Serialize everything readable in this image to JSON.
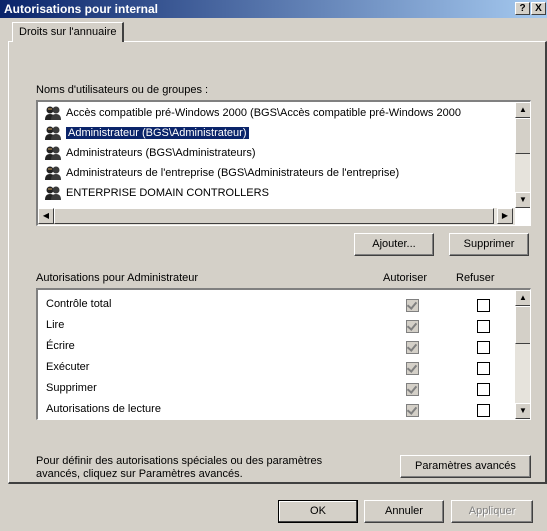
{
  "window": {
    "title": "Autorisations pour internal",
    "help_button": "?",
    "close_button": "X"
  },
  "tab": {
    "label": "Droits sur l'annuaire"
  },
  "users_section": {
    "label": "Noms d'utilisateurs ou de groupes :",
    "items": [
      {
        "label": "Accès compatible pré-Windows 2000 (BGS\\Accès compatible pré-Windows 2000"
      },
      {
        "label": "Administrateur (BGS\\Administrateur)",
        "selected": true
      },
      {
        "label": "Administrateurs (BGS\\Administrateurs)"
      },
      {
        "label": "Administrateurs de l'entreprise (BGS\\Administrateurs de l'entreprise)"
      },
      {
        "label": "ENTERPRISE DOMAIN CONTROLLERS"
      }
    ],
    "add_button": "Ajouter...",
    "remove_button": "Supprimer"
  },
  "permissions_section": {
    "label": "Autorisations pour Administrateur",
    "allow_header": "Autoriser",
    "deny_header": "Refuser",
    "rows": [
      {
        "label": "Contrôle total",
        "allow": true,
        "deny": false
      },
      {
        "label": "Lire",
        "allow": true,
        "deny": false
      },
      {
        "label": "Écrire",
        "allow": true,
        "deny": false
      },
      {
        "label": "Exécuter",
        "allow": true,
        "deny": false
      },
      {
        "label": "Supprimer",
        "allow": true,
        "deny": false
      },
      {
        "label": "Autorisations de lecture",
        "allow": true,
        "deny": false
      }
    ]
  },
  "advanced": {
    "text_line1": "Pour définir des autorisations spéciales ou des paramètres",
    "text_line2": "avancés, cliquez sur Paramètres avancés.",
    "button": "Paramètres avancés"
  },
  "footer": {
    "ok": "OK",
    "cancel": "Annuler",
    "apply": "Appliquer"
  }
}
